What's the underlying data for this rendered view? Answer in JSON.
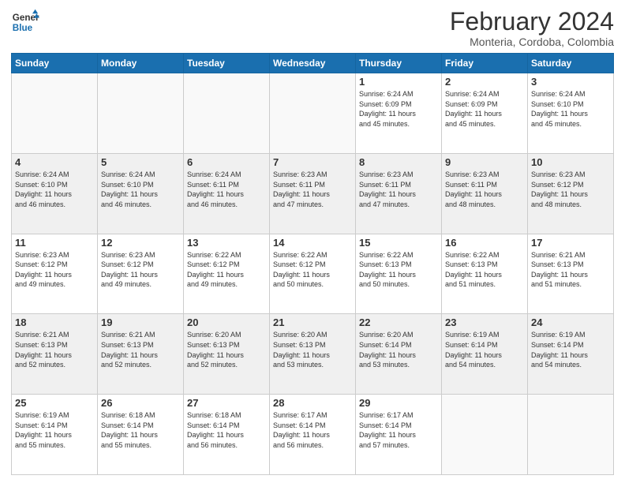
{
  "header": {
    "logo_line1": "General",
    "logo_line2": "Blue",
    "title": "February 2024",
    "subtitle": "Monteria, Cordoba, Colombia"
  },
  "weekdays": [
    "Sunday",
    "Monday",
    "Tuesday",
    "Wednesday",
    "Thursday",
    "Friday",
    "Saturday"
  ],
  "weeks": [
    [
      {
        "day": "",
        "info": ""
      },
      {
        "day": "",
        "info": ""
      },
      {
        "day": "",
        "info": ""
      },
      {
        "day": "",
        "info": ""
      },
      {
        "day": "1",
        "info": "Sunrise: 6:24 AM\nSunset: 6:09 PM\nDaylight: 11 hours\nand 45 minutes."
      },
      {
        "day": "2",
        "info": "Sunrise: 6:24 AM\nSunset: 6:09 PM\nDaylight: 11 hours\nand 45 minutes."
      },
      {
        "day": "3",
        "info": "Sunrise: 6:24 AM\nSunset: 6:10 PM\nDaylight: 11 hours\nand 45 minutes."
      }
    ],
    [
      {
        "day": "4",
        "info": "Sunrise: 6:24 AM\nSunset: 6:10 PM\nDaylight: 11 hours\nand 46 minutes."
      },
      {
        "day": "5",
        "info": "Sunrise: 6:24 AM\nSunset: 6:10 PM\nDaylight: 11 hours\nand 46 minutes."
      },
      {
        "day": "6",
        "info": "Sunrise: 6:24 AM\nSunset: 6:11 PM\nDaylight: 11 hours\nand 46 minutes."
      },
      {
        "day": "7",
        "info": "Sunrise: 6:23 AM\nSunset: 6:11 PM\nDaylight: 11 hours\nand 47 minutes."
      },
      {
        "day": "8",
        "info": "Sunrise: 6:23 AM\nSunset: 6:11 PM\nDaylight: 11 hours\nand 47 minutes."
      },
      {
        "day": "9",
        "info": "Sunrise: 6:23 AM\nSunset: 6:11 PM\nDaylight: 11 hours\nand 48 minutes."
      },
      {
        "day": "10",
        "info": "Sunrise: 6:23 AM\nSunset: 6:12 PM\nDaylight: 11 hours\nand 48 minutes."
      }
    ],
    [
      {
        "day": "11",
        "info": "Sunrise: 6:23 AM\nSunset: 6:12 PM\nDaylight: 11 hours\nand 49 minutes."
      },
      {
        "day": "12",
        "info": "Sunrise: 6:23 AM\nSunset: 6:12 PM\nDaylight: 11 hours\nand 49 minutes."
      },
      {
        "day": "13",
        "info": "Sunrise: 6:22 AM\nSunset: 6:12 PM\nDaylight: 11 hours\nand 49 minutes."
      },
      {
        "day": "14",
        "info": "Sunrise: 6:22 AM\nSunset: 6:12 PM\nDaylight: 11 hours\nand 50 minutes."
      },
      {
        "day": "15",
        "info": "Sunrise: 6:22 AM\nSunset: 6:13 PM\nDaylight: 11 hours\nand 50 minutes."
      },
      {
        "day": "16",
        "info": "Sunrise: 6:22 AM\nSunset: 6:13 PM\nDaylight: 11 hours\nand 51 minutes."
      },
      {
        "day": "17",
        "info": "Sunrise: 6:21 AM\nSunset: 6:13 PM\nDaylight: 11 hours\nand 51 minutes."
      }
    ],
    [
      {
        "day": "18",
        "info": "Sunrise: 6:21 AM\nSunset: 6:13 PM\nDaylight: 11 hours\nand 52 minutes."
      },
      {
        "day": "19",
        "info": "Sunrise: 6:21 AM\nSunset: 6:13 PM\nDaylight: 11 hours\nand 52 minutes."
      },
      {
        "day": "20",
        "info": "Sunrise: 6:20 AM\nSunset: 6:13 PM\nDaylight: 11 hours\nand 52 minutes."
      },
      {
        "day": "21",
        "info": "Sunrise: 6:20 AM\nSunset: 6:13 PM\nDaylight: 11 hours\nand 53 minutes."
      },
      {
        "day": "22",
        "info": "Sunrise: 6:20 AM\nSunset: 6:14 PM\nDaylight: 11 hours\nand 53 minutes."
      },
      {
        "day": "23",
        "info": "Sunrise: 6:19 AM\nSunset: 6:14 PM\nDaylight: 11 hours\nand 54 minutes."
      },
      {
        "day": "24",
        "info": "Sunrise: 6:19 AM\nSunset: 6:14 PM\nDaylight: 11 hours\nand 54 minutes."
      }
    ],
    [
      {
        "day": "25",
        "info": "Sunrise: 6:19 AM\nSunset: 6:14 PM\nDaylight: 11 hours\nand 55 minutes."
      },
      {
        "day": "26",
        "info": "Sunrise: 6:18 AM\nSunset: 6:14 PM\nDaylight: 11 hours\nand 55 minutes."
      },
      {
        "day": "27",
        "info": "Sunrise: 6:18 AM\nSunset: 6:14 PM\nDaylight: 11 hours\nand 56 minutes."
      },
      {
        "day": "28",
        "info": "Sunrise: 6:17 AM\nSunset: 6:14 PM\nDaylight: 11 hours\nand 56 minutes."
      },
      {
        "day": "29",
        "info": "Sunrise: 6:17 AM\nSunset: 6:14 PM\nDaylight: 11 hours\nand 57 minutes."
      },
      {
        "day": "",
        "info": ""
      },
      {
        "day": "",
        "info": ""
      }
    ]
  ]
}
